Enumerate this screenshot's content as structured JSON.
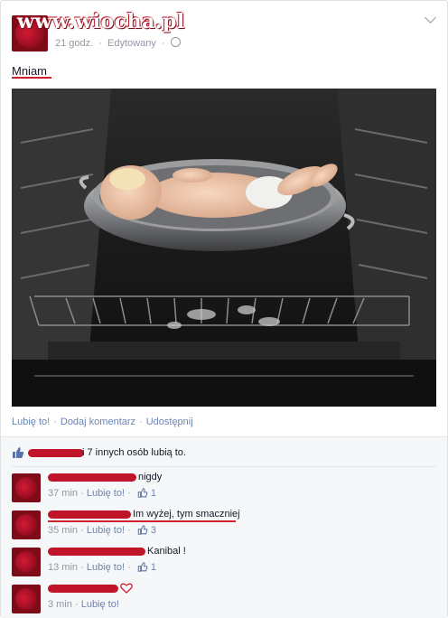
{
  "watermark": "www.wiocha.pl",
  "post": {
    "time": "21 godz.",
    "edited": "Edytowany",
    "sep": "·",
    "text": "Mniam",
    "actions": [
      "Lubię to!",
      "Dodaj komentarz",
      "Udostępnij"
    ]
  },
  "likes": {
    "text": "i 7 innych osób lubią to."
  },
  "comments": [
    {
      "text": "nigdy",
      "time": "37 min",
      "like_label": "Lubię to!",
      "like_count": "1"
    },
    {
      "text": "Im wyżej, tym smaczniej",
      "time": "35 min",
      "like_label": "Lubię to!",
      "like_count": "3"
    },
    {
      "text": "Kanibal !",
      "time": "13 min",
      "like_label": "Lubię to!",
      "like_count": "1"
    },
    {
      "text": "",
      "time": "3 min",
      "like_label": "Lubię to!",
      "like_count": ""
    }
  ],
  "colors": {
    "link": "#6d84b4",
    "meta": "#9197a3",
    "redaction": "#c0142a"
  }
}
